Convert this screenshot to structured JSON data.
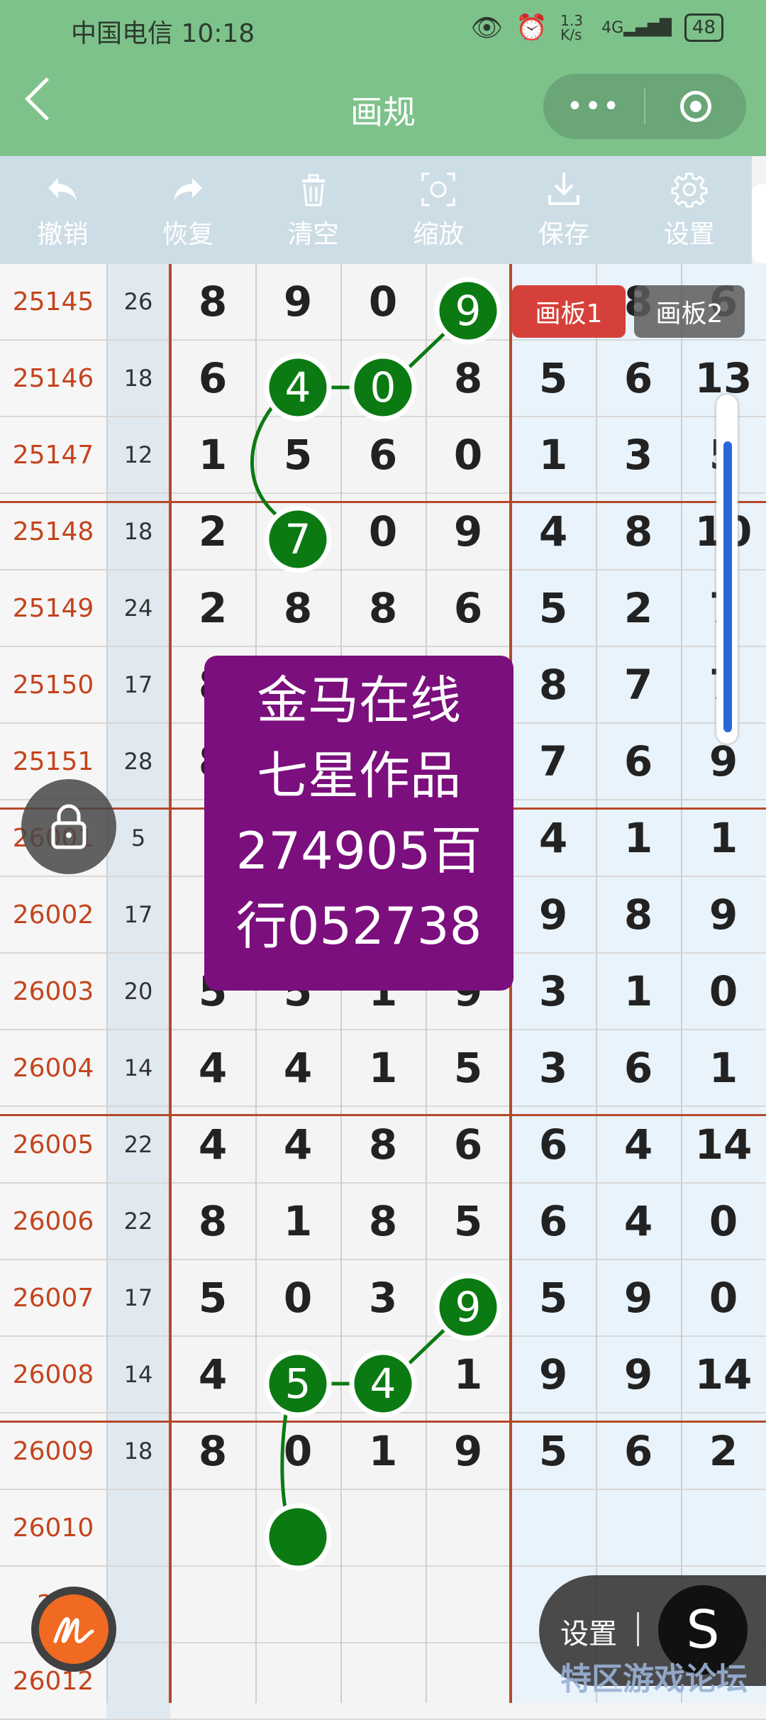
{
  "status_bar": {
    "carrier_time": "中国电信 10:18",
    "speed": "1.3 K/s",
    "signal": "4G",
    "battery": "48"
  },
  "nav": {
    "title": "画规",
    "more_dots": "•••"
  },
  "toolbar": [
    {
      "icon": "undo-icon",
      "label": "撤销"
    },
    {
      "icon": "redo-icon",
      "label": "恢复"
    },
    {
      "icon": "trash-icon",
      "label": "清空"
    },
    {
      "icon": "zoom-icon",
      "label": "缩放"
    },
    {
      "icon": "download-icon",
      "label": "保存"
    },
    {
      "icon": "gear-icon",
      "label": "设置"
    }
  ],
  "rows": [
    {
      "period": "25145",
      "sum": "26",
      "digits": [
        "8",
        "9",
        "0",
        "9",
        "",
        "8",
        "6"
      ]
    },
    {
      "period": "25146",
      "sum": "18",
      "digits": [
        "6",
        "4",
        "0",
        "8",
        "5",
        "6",
        "13"
      ]
    },
    {
      "period": "25147",
      "sum": "12",
      "digits": [
        "1",
        "5",
        "6",
        "0",
        "1",
        "3",
        "5"
      ]
    },
    {
      "period": "25148",
      "sum": "18",
      "digits": [
        "2",
        "7",
        "0",
        "9",
        "4",
        "8",
        "10"
      ]
    },
    {
      "period": "25149",
      "sum": "24",
      "digits": [
        "2",
        "8",
        "8",
        "6",
        "5",
        "2",
        "7"
      ]
    },
    {
      "period": "25150",
      "sum": "17",
      "digits": [
        "8",
        "",
        "",
        "",
        "8",
        "7",
        "7"
      ]
    },
    {
      "period": "25151",
      "sum": "28",
      "digits": [
        "8",
        "",
        "",
        "",
        "7",
        "6",
        "9"
      ]
    },
    {
      "period": "26001",
      "sum": "5",
      "digits": [
        "",
        "",
        "",
        "",
        "4",
        "1",
        "1"
      ]
    },
    {
      "period": "26002",
      "sum": "17",
      "digits": [
        "",
        "",
        "",
        "",
        "9",
        "8",
        "9"
      ]
    },
    {
      "period": "26003",
      "sum": "20",
      "digits": [
        "5",
        "5",
        "1",
        "9",
        "3",
        "1",
        "0"
      ]
    },
    {
      "period": "26004",
      "sum": "14",
      "digits": [
        "4",
        "4",
        "1",
        "5",
        "3",
        "6",
        "1"
      ]
    },
    {
      "period": "26005",
      "sum": "22",
      "digits": [
        "4",
        "4",
        "8",
        "6",
        "6",
        "4",
        "14"
      ]
    },
    {
      "period": "26006",
      "sum": "22",
      "digits": [
        "8",
        "1",
        "8",
        "5",
        "6",
        "4",
        "0"
      ]
    },
    {
      "period": "26007",
      "sum": "17",
      "digits": [
        "5",
        "0",
        "3",
        "9",
        "5",
        "9",
        "0"
      ]
    },
    {
      "period": "26008",
      "sum": "14",
      "digits": [
        "4",
        "5",
        "4",
        "1",
        "9",
        "9",
        "14"
      ]
    },
    {
      "period": "26009",
      "sum": "18",
      "digits": [
        "8",
        "0",
        "1",
        "9",
        "5",
        "6",
        "2"
      ]
    },
    {
      "period": "26010",
      "sum": "",
      "digits": [
        "",
        "",
        "",
        "",
        "",
        "",
        ""
      ]
    },
    {
      "period": "26",
      "sum": "",
      "digits": [
        "",
        "",
        "",
        "",
        "",
        "",
        ""
      ]
    },
    {
      "period": "26012",
      "sum": "",
      "digits": [
        "",
        "",
        "",
        "",
        "",
        "",
        ""
      ]
    }
  ],
  "markers": [
    "9",
    "4",
    "0",
    "7",
    "9",
    "5",
    "4",
    ""
  ],
  "board_tags": {
    "tag1": "画板1",
    "tag2": "画板2"
  },
  "overlay_text": [
    "金马在线",
    "七星作品",
    "274905百",
    "行052738"
  ],
  "floating": {
    "settings_label": "设置",
    "s_button": "S"
  },
  "watermark": "特区游戏论坛",
  "colors": {
    "nav_green": "#7ec28b",
    "marker_green": "#0b7a12",
    "period_red": "#c4441c",
    "purple": "#7b0f7d",
    "tag_red": "#d6403a"
  }
}
